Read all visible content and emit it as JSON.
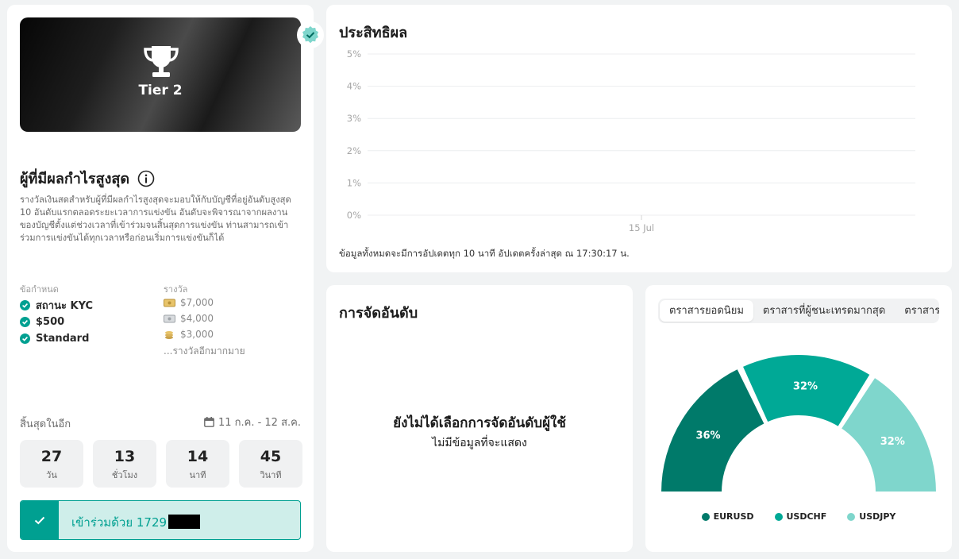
{
  "competition": {
    "tier": "Tier 2",
    "title": "ผู้ที่มีผลกำไรสูงสุด",
    "description": "รางวัลเงินสดสำหรับผู้ที่มีผลกำไรสูงสุดจะมอบให้กับบัญชีที่อยู่อันดับสูงสุด 10 อันดับแรกตลอดระยะเวลาการแข่งขัน อันดับจะพิจารณาจากผลงานของบัญชีตั้งแต่ช่วงเวลาที่เข้าร่วมจนสิ้นสุดการแข่งขัน ท่านสามารถเข้าร่วมการแข่งขันได้ทุกเวลาหรือก่อนเริ่มการแข่งขันก็ได้",
    "requirements_label": "ข้อกำหนด",
    "requirements": [
      "สถานะ KYC",
      "$500",
      "Standard"
    ],
    "prizes_label": "รางวัล",
    "prizes": [
      "$7,000",
      "$4,000",
      "$3,000"
    ],
    "prizes_more": "...รางวัลอีกมากมาย",
    "ends_label": "สิ้นสุดในอีก",
    "date_range": "11 ก.ค. - 12 ส.ค.",
    "countdown": [
      {
        "value": "27",
        "label": "วัน"
      },
      {
        "value": "13",
        "label": "ชั่วโมง"
      },
      {
        "value": "14",
        "label": "นาที"
      },
      {
        "value": "45",
        "label": "วินาที"
      }
    ],
    "join_label": "เข้าร่วมด้วย 1729"
  },
  "performance": {
    "title": "ประสิทธิผล",
    "note": "ข้อมูลทั้งหมดจะมีการอัปเดตทุก 10 นาที อัปเดตครั้งล่าสุด ณ 17:30:17 น."
  },
  "ranking": {
    "title": "การจัดอันดับ",
    "empty_title": "ยังไม่ได้เลือกการจัดอันดับผู้ใช้",
    "empty_sub": "ไม่มีข้อมูลที่จะแสดง"
  },
  "symbols": {
    "tabs": [
      "ตราสารยอดนิยม",
      "ตราสารที่ผู้ชนะเทรดมากสุด",
      "ตราสาร"
    ]
  },
  "colors": {
    "accent": "#00a091",
    "eurusd": "#007a6a",
    "usdchf": "#00a996",
    "usdjpy": "#7fd6cc"
  },
  "chart_data": [
    {
      "type": "line",
      "x": [
        "15 Jul"
      ],
      "yticks": [
        "0%",
        "1%",
        "2%",
        "3%",
        "4%",
        "5%"
      ],
      "ylim": [
        0,
        5
      ],
      "series": []
    },
    {
      "type": "pie",
      "categories": [
        "EURUSD",
        "USDCHF",
        "USDJPY"
      ],
      "values": [
        36,
        32,
        32
      ],
      "labels": [
        "36%",
        "32%",
        "32%"
      ]
    }
  ]
}
